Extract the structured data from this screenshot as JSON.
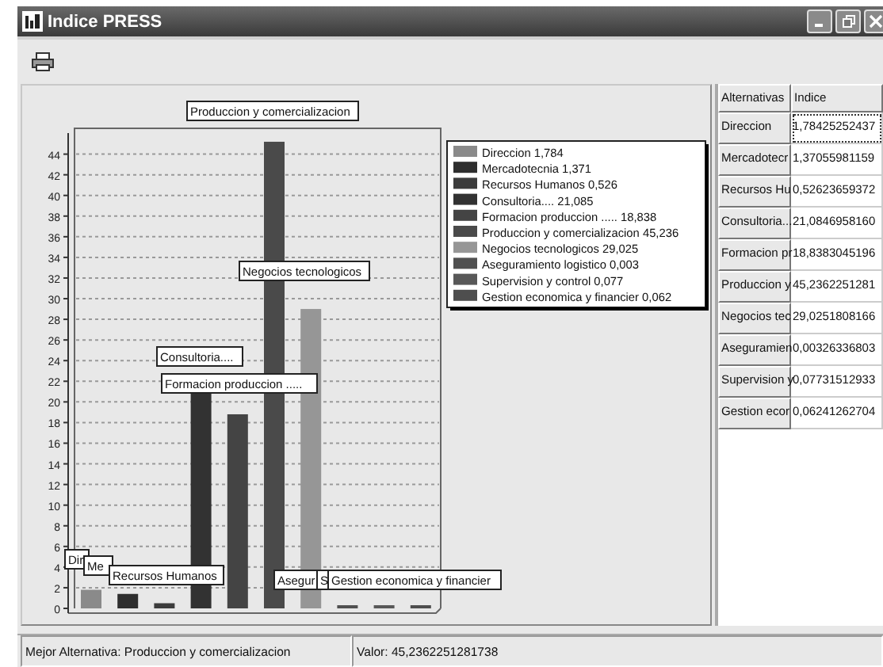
{
  "window": {
    "title": "Indice PRESS"
  },
  "chart": {
    "chart_data": {
      "type": "bar",
      "grid": true,
      "values": [
        1.8,
        1.4,
        0.5,
        21.1,
        18.8,
        45.2,
        29.0,
        0.0,
        0.1,
        0.1
      ],
      "ylim": [
        0,
        46.5
      ],
      "yticks": [
        0,
        2,
        4,
        6,
        8,
        10,
        12,
        14,
        16,
        18,
        20,
        22,
        24,
        26,
        28,
        30,
        32,
        34,
        36,
        38,
        40,
        42,
        44
      ],
      "annotations": [
        "Dir",
        "Me",
        "Recursos Humanos",
        "Consultoria....",
        "Formacion produccion .....",
        "Produccion y comercializacion",
        "Negocios tecnologicos",
        "Asegur",
        "S",
        "Gestion economica y financier"
      ]
    },
    "legend": [
      {
        "label": "Direccion 1,784",
        "color": "#8a8a8a"
      },
      {
        "label": "Mercadotecnia 1,371",
        "color": "#2e2e2e"
      },
      {
        "label": "Recursos Humanos 0,526",
        "color": "#3c3c3c"
      },
      {
        "label": "Consultoria.... 21,085",
        "color": "#323232"
      },
      {
        "label": "Formacion produccion ..... 18,838",
        "color": "#444444"
      },
      {
        "label": "Produccion y comercializacion 45,236",
        "color": "#4a4a4a"
      },
      {
        "label": "Negocios tecnologicos 29,025",
        "color": "#969696"
      },
      {
        "label": "Aseguramiento logistico 0,003",
        "color": "#505050"
      },
      {
        "label": "Supervision y control 0,077",
        "color": "#585858"
      },
      {
        "label": "Gestion economica y financier 0,062",
        "color": "#4e4e4e"
      }
    ]
  },
  "table": {
    "columns": [
      "Alternativas",
      "Indice"
    ],
    "rows": [
      {
        "name": "Direccion",
        "value": "1,78425252437",
        "selected": true
      },
      {
        "name": "Mercadotecr",
        "value": "1,37055981159",
        "selected": false
      },
      {
        "name": "Recursos Hu",
        "value": "0,52623659372",
        "selected": false
      },
      {
        "name": "Consultoria...",
        "value": "21,0846958160",
        "selected": false
      },
      {
        "name": "Formacion pr",
        "value": "18,8383045196",
        "selected": false
      },
      {
        "name": "Produccion y",
        "value": "45,2362251281",
        "selected": false
      },
      {
        "name": "Negocios tec",
        "value": "29,0251808166",
        "selected": false
      },
      {
        "name": "Aseguramien",
        "value": "0,00326336803",
        "selected": false
      },
      {
        "name": "Supervision y",
        "value": "0,07731512933",
        "selected": false
      },
      {
        "name": "Gestion ecor",
        "value": "0,06241262704",
        "selected": false
      }
    ]
  },
  "status_bar": [
    "Mejor Alternativa: Produccion y comercializacion",
    "Valor: 45,2362251281738"
  ]
}
